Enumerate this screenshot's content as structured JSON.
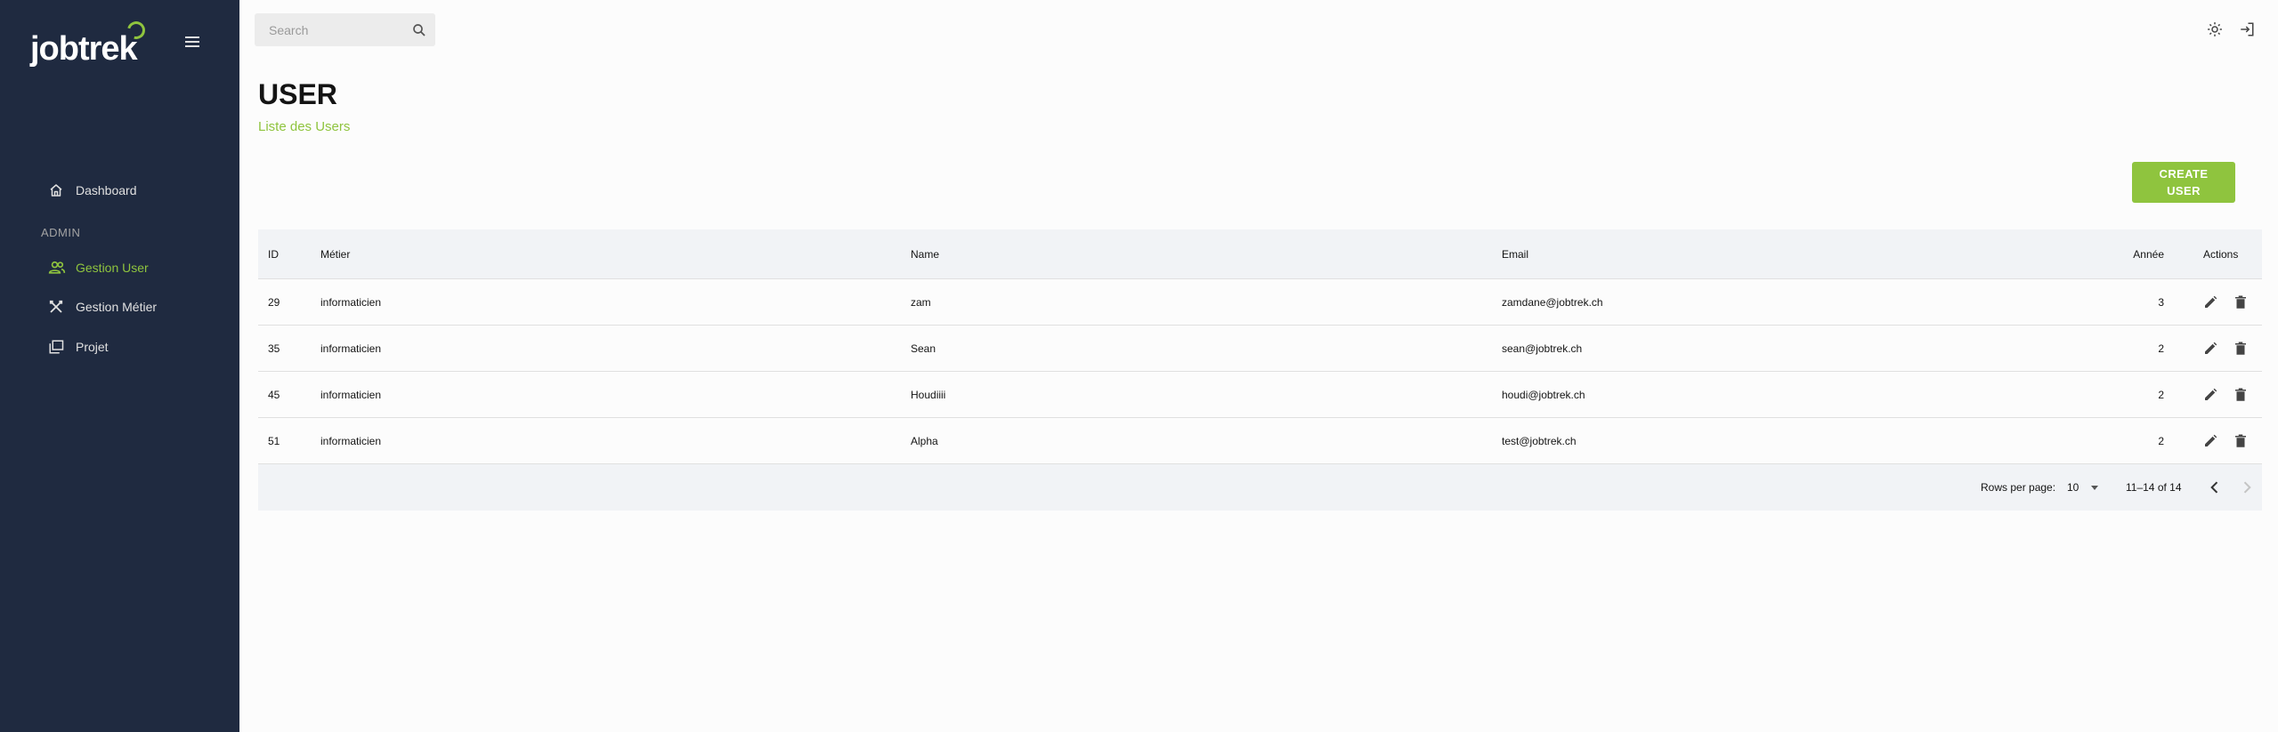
{
  "brand": {
    "name": "jobtrek"
  },
  "sidebar": {
    "dashboard": "Dashboard",
    "section_admin": "ADMIN",
    "gestion_user": "Gestion User",
    "gestion_metier": "Gestion Métier",
    "projet": "Projet"
  },
  "search": {
    "placeholder": "Search"
  },
  "header": {
    "title": "USER",
    "subtitle": "Liste des Users"
  },
  "actions": {
    "create_user": "CREATE USER"
  },
  "table": {
    "headers": {
      "id": "ID",
      "metier": "Métier",
      "name": "Name",
      "email": "Email",
      "annee": "Année",
      "actions": "Actions"
    },
    "rows": [
      {
        "id": "29",
        "metier": "informaticien",
        "name": "zam",
        "email": "zamdane@jobtrek.ch",
        "annee": "3"
      },
      {
        "id": "35",
        "metier": "informaticien",
        "name": "Sean",
        "email": "sean@jobtrek.ch",
        "annee": "2"
      },
      {
        "id": "45",
        "metier": "informaticien",
        "name": "Houdiiii",
        "email": "houdi@jobtrek.ch",
        "annee": "2"
      },
      {
        "id": "51",
        "metier": "informaticien",
        "name": "Alpha",
        "email": "test@jobtrek.ch",
        "annee": "2"
      }
    ]
  },
  "pagination": {
    "rows_per_page_label": "Rows per page:",
    "rows_per_page_value": "10",
    "range": "11–14 of 14"
  },
  "colors": {
    "sidebar_bg": "#1f2a40",
    "accent": "#8fc43e",
    "table_header_bg": "#f1f3f6"
  },
  "icons": {
    "menu": "menu-icon",
    "search": "search-icon",
    "theme": "sun-icon",
    "logout": "logout-icon",
    "dashboard": "home-icon",
    "users": "people-icon",
    "metier": "tools-icon",
    "projet": "folders-icon",
    "edit": "pencil-icon",
    "delete": "trash-icon",
    "prev": "chevron-left-icon",
    "next": "chevron-right-icon"
  }
}
